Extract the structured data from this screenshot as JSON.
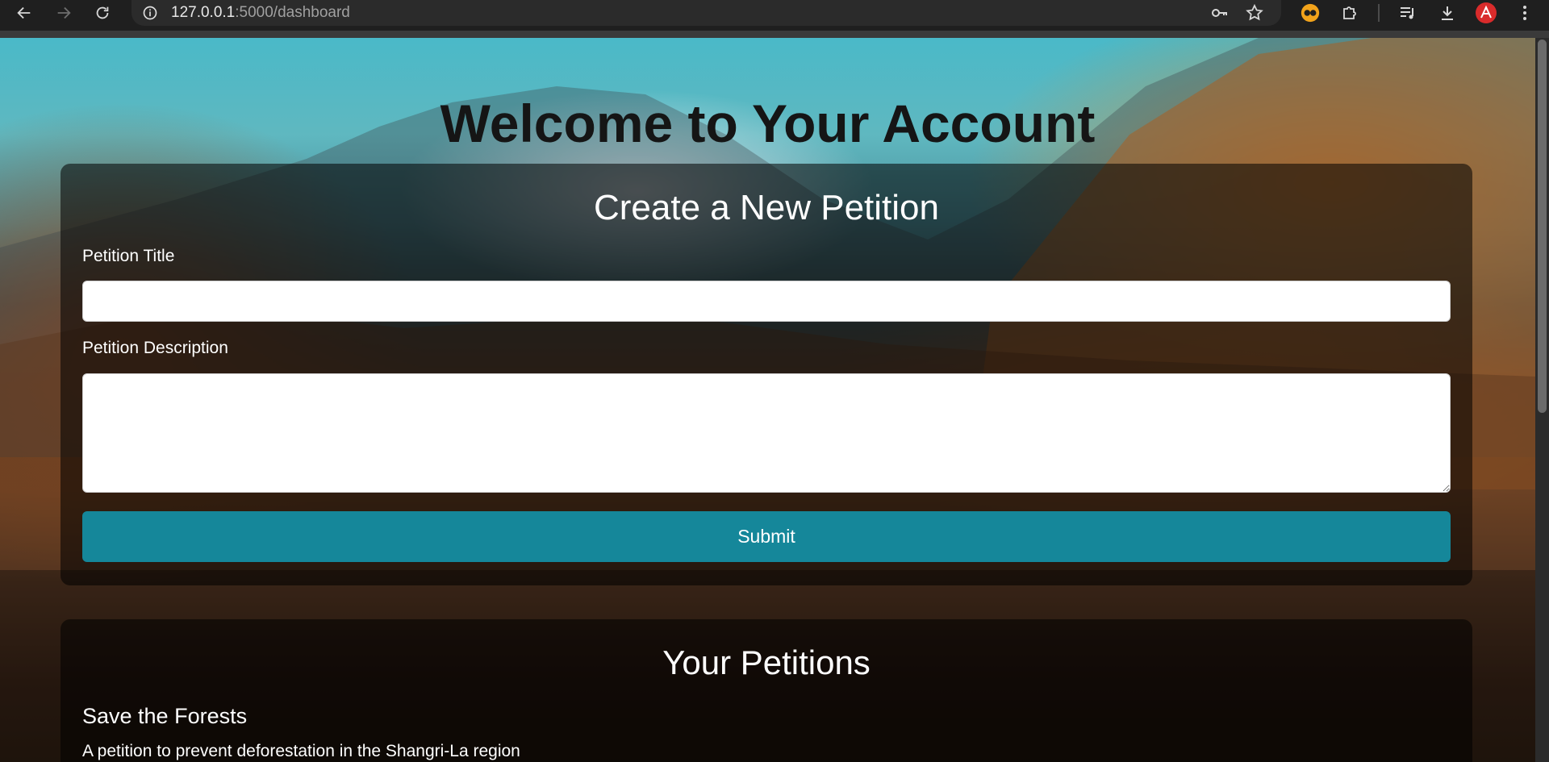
{
  "browser": {
    "url_host": "127.0.0.1",
    "url_path": ":5000/dashboard",
    "icons": {
      "back": "arrow-left-icon",
      "forward": "arrow-right-icon",
      "reload": "reload-icon",
      "site_info": "info-icon",
      "password": "key-icon",
      "bookmark": "star-icon",
      "extension_1": "glasses-extension-icon",
      "extensions": "puzzle-icon",
      "media": "playlist-icon",
      "downloads": "download-icon",
      "profile": "profile-avatar-icon",
      "menu": "kebab-menu-icon"
    }
  },
  "page": {
    "heading": "Welcome to Your Account",
    "create_panel": {
      "title": "Create a New Petition",
      "title_label": "Petition Title",
      "title_value": "",
      "description_label": "Petition Description",
      "description_value": "",
      "submit_label": "Submit"
    },
    "list_panel": {
      "title": "Your Petitions",
      "petitions": [
        {
          "title": "Save the Forests",
          "description": "A petition to prevent deforestation in the Shangri-La region"
        }
      ]
    }
  },
  "colors": {
    "submit_button": "#15879a",
    "panel_overlay": "rgba(0,0,0,0.55)",
    "heading_text": "#151515"
  }
}
